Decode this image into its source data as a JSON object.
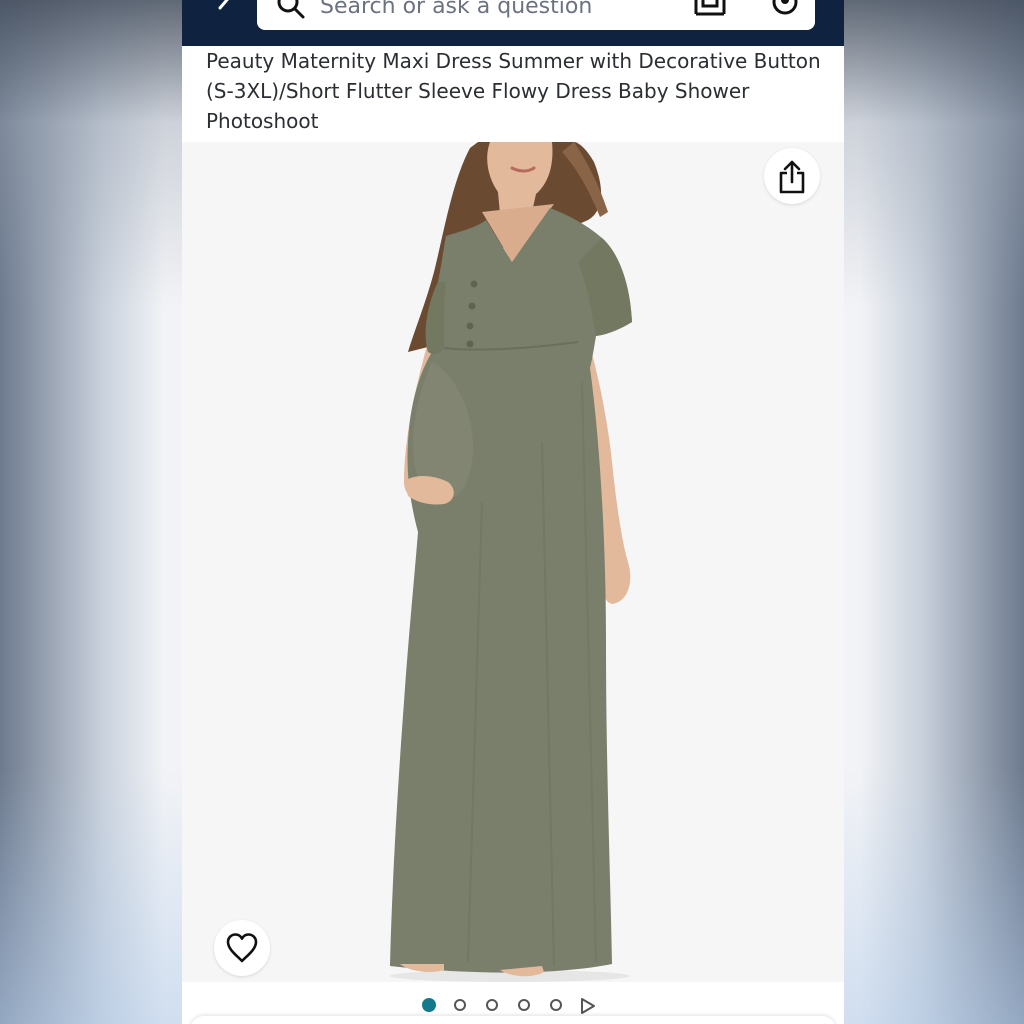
{
  "header": {
    "search_placeholder": "Search or ask a question",
    "icons": [
      "back-arrow-icon",
      "search-icon",
      "camera-lens-icon",
      "microphone-icon"
    ],
    "bar_color": "#0f2340"
  },
  "product": {
    "title": "Peauty Maternity Maxi Dress Summer with Decorative Button (S-3XL)/Short Flutter Sleeve Flowy Dress Baby Shower Photoshoot",
    "dress_color": "#7a7f6c"
  },
  "gallery": {
    "image_count": 5,
    "active_index": 0,
    "has_video": true,
    "accent_color": "#127a8a",
    "icons": [
      "share-icon",
      "heart-icon",
      "play-icon"
    ]
  }
}
